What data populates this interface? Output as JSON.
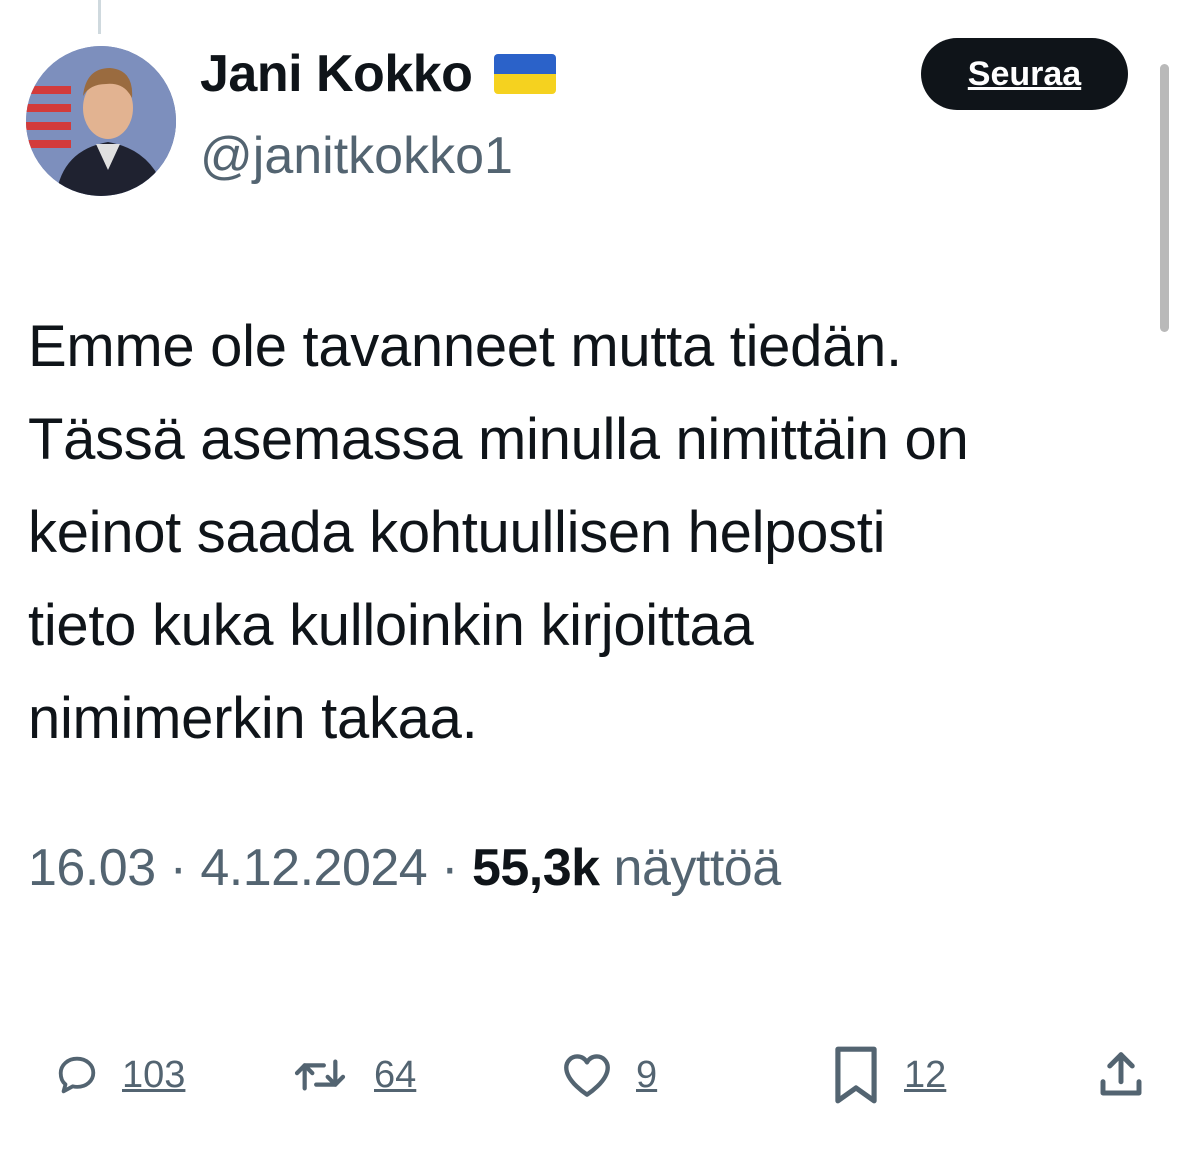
{
  "author": {
    "display_name": "Jani Kokko",
    "handle": "@janitkokko1",
    "flag_icon": "ukraine-flag-icon",
    "flag_colors": {
      "top": "#2b62c9",
      "bottom": "#f5d21f"
    }
  },
  "follow_button": {
    "label": "Seuraa"
  },
  "tweet": {
    "lines": [
      "Emme ole tavanneet mutta tiedän.",
      "Tässä asemassa minulla nimittäin on",
      "keinot saada kohtuullisen helposti",
      "tieto kuka kulloinkin kirjoittaa",
      "nimimerkin takaa."
    ]
  },
  "meta": {
    "time": "16.03",
    "separator": "·",
    "date": "4.12.2024",
    "views_count": "55,3k",
    "views_label": "näyttöä"
  },
  "actions": {
    "replies": {
      "icon": "reply-icon",
      "count": "103"
    },
    "reposts": {
      "icon": "repost-icon",
      "count": "64"
    },
    "likes": {
      "icon": "heart-icon",
      "count": "9"
    },
    "bookmarks": {
      "icon": "bookmark-icon",
      "count": "12"
    },
    "share": {
      "icon": "share-icon"
    }
  }
}
